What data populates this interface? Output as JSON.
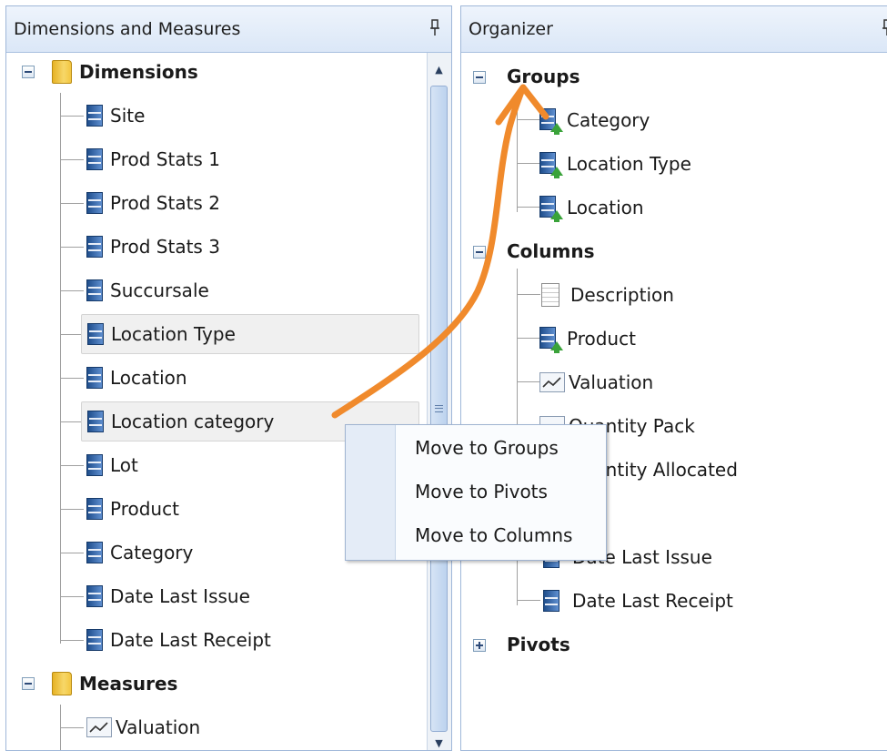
{
  "left_panel": {
    "title": "Dimensions and Measures",
    "dimensions_folder": "Dimensions",
    "dimensions": [
      "Site",
      "Prod Stats 1",
      "Prod Stats 2",
      "Prod Stats 3",
      "Succursale",
      "Location Type",
      "Location",
      "Location category",
      "Lot",
      "Product",
      "Category",
      "Date Last Issue",
      "Date Last Receipt"
    ],
    "measures_folder": "Measures",
    "measures": [
      "Valuation"
    ]
  },
  "right_panel": {
    "title": "Organizer",
    "groups_label": "Groups",
    "groups": [
      "Category",
      "Location Type",
      "Location"
    ],
    "columns_label": "Columns",
    "columns": [
      "Description",
      "Product",
      "Valuation",
      "Quantity Pack",
      "Quantity Allocated",
      "",
      "Date Last Issue",
      "Date Last Receipt"
    ],
    "pivots_label": "Pivots"
  },
  "context_menu": {
    "items": [
      "Move to Groups",
      "Move to Pivots",
      "Move to Columns"
    ]
  },
  "icons": {
    "expander_open": "minus-box-icon",
    "expander_closed": "plus-box-icon",
    "folder": "folder-icon",
    "dimension": "dimension-icon",
    "group_dimension": "group-dimension-icon",
    "measure": "measure-chart-icon",
    "text_column": "document-icon",
    "pin": "pin-icon"
  },
  "colors": {
    "panel_border": "#9fb7d9",
    "header_gradient_top": "#eef4fc",
    "header_gradient_bottom": "#dbe7f7",
    "selection_highlight": "#f0f0f0",
    "annotation_arrow": "#f08a2c"
  }
}
